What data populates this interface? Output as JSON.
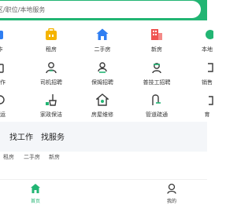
{
  "search": {
    "placeholder_text": "区/职位/本地服务"
  },
  "grid": {
    "row1": [
      "作",
      "租房",
      "二手房",
      "新房",
      "本地"
    ],
    "row2": [
      "工作",
      "司机招聘",
      "保姆招聘",
      "普技工招聘",
      "销售"
    ],
    "row3": [
      "搬运",
      "家政保洁",
      "房屋维修",
      "管道疏通",
      "育"
    ]
  },
  "find_tabs": [
    "找工作",
    "找服务"
  ],
  "sub_tabs": [
    "租房",
    "二手房",
    "新房"
  ],
  "bottom_nav": {
    "home_label": "首页",
    "mine_label": "我的"
  },
  "colors": {
    "brand_green": "#22b573",
    "house_blue": "#2f7ef2",
    "building_red": "#ef5350",
    "rent_yellow": "#f5b400",
    "icon_dark": "#3a3a3a"
  }
}
